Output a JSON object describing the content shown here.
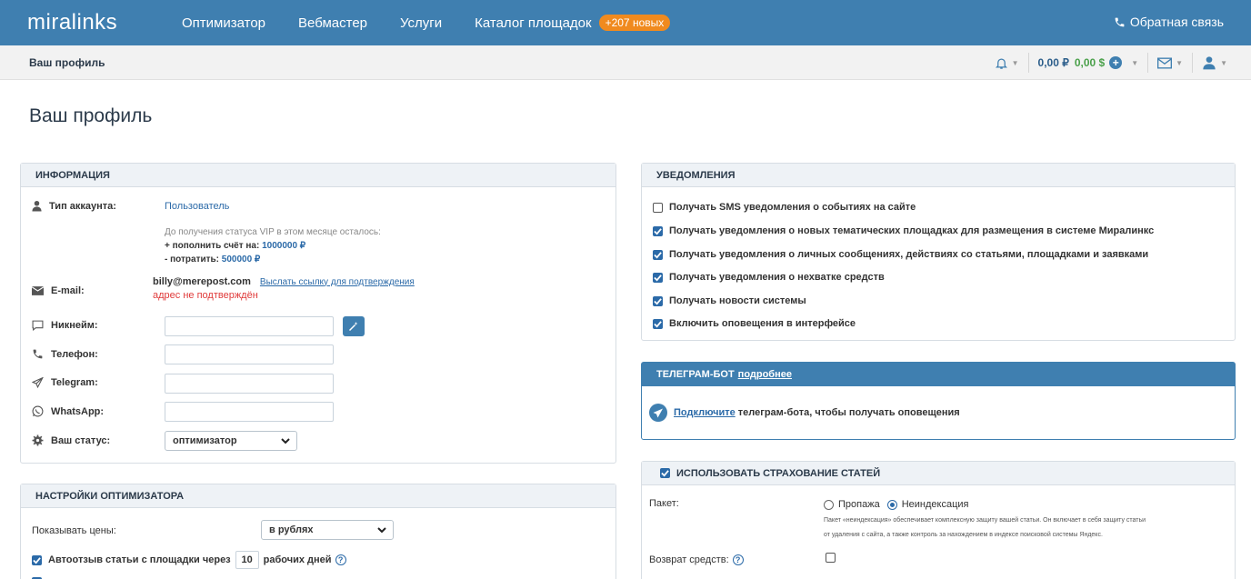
{
  "header": {
    "logo": "miralinks",
    "nav": [
      "Оптимизатор",
      "Вебмастер",
      "Услуги",
      "Каталог площадок"
    ],
    "catalog_badge": "+207 новых",
    "feedback": "Обратная связь"
  },
  "subheader": {
    "breadcrumb": "Ваш профиль",
    "balance_rub": "0,00 ₽",
    "balance_usd": "0,00 $"
  },
  "page_title": "Ваш профиль",
  "info": {
    "title": "ИНФОРМАЦИЯ",
    "account_type_label": "Тип аккаунта:",
    "account_type_value": "Пользователь",
    "vip_note": "До получения статуса VIP в этом месяце осталось:",
    "topup_label": "+ пополнить счёт на:",
    "topup_value": "1000000 ₽",
    "spend_label": "- потратить:",
    "spend_value": "500000 ₽",
    "email_label": "E-mail:",
    "email_value": "billy@merepost.com",
    "email_link": "Выслать ссылку для подтверждения",
    "email_status": "адрес не подтверждён",
    "nickname_label": "Никнейм:",
    "phone_label": "Телефон:",
    "telegram_label": "Telegram:",
    "whatsapp_label": "WhatsApp:",
    "status_label": "Ваш статус:",
    "status_value": "оптимизатор"
  },
  "optimizer": {
    "title": "НАСТРОЙКИ ОПТИМИЗАТОРА",
    "prices_label": "Показывать цены:",
    "prices_value": "в рублях",
    "auto_review_pre": "Автоотзыв статьи с площадки через",
    "auto_review_days": "10",
    "auto_review_post": "рабочих дней"
  },
  "notifications": {
    "title": "УВЕДОМЛЕНИЯ",
    "items": [
      {
        "label": "Получать SMS уведомления о событиях на сайте",
        "checked": false
      },
      {
        "label": "Получать уведомления о новых тематических площадках для размещения в системе Миралинкс",
        "checked": true
      },
      {
        "label": "Получать уведомления о личных сообщениях, действиях со статьями, площадками и заявками",
        "checked": true
      },
      {
        "label": "Получать уведомления о нехватке средств",
        "checked": true
      },
      {
        "label": "Получать новости системы",
        "checked": true
      },
      {
        "label": "Включить оповещения в интерфейсе",
        "checked": true
      }
    ]
  },
  "telegram_bot": {
    "title": "ТЕЛЕГРАМ-БОТ",
    "more_link": "подробнее",
    "connect_link": "Подключите",
    "connect_text": "телеграм-бота, чтобы получать оповещения"
  },
  "insurance": {
    "title": "ИСПОЛЬЗОВАТЬ СТРАХОВАНИЕ СТАТЕЙ",
    "package_label": "Пакет:",
    "option_loss": "Пропажа",
    "option_noindex": "Неиндексация",
    "description_line1": "Пакет «неиндексация» обеспечивает комплексную защиту вашей статьи. Он включает в себя защиту статьи",
    "description_line2": "от удаления с сайта, а также контроль за нахождением в индексе поисковой системы Яндекс.",
    "refund_label": "Возврат средств:"
  }
}
